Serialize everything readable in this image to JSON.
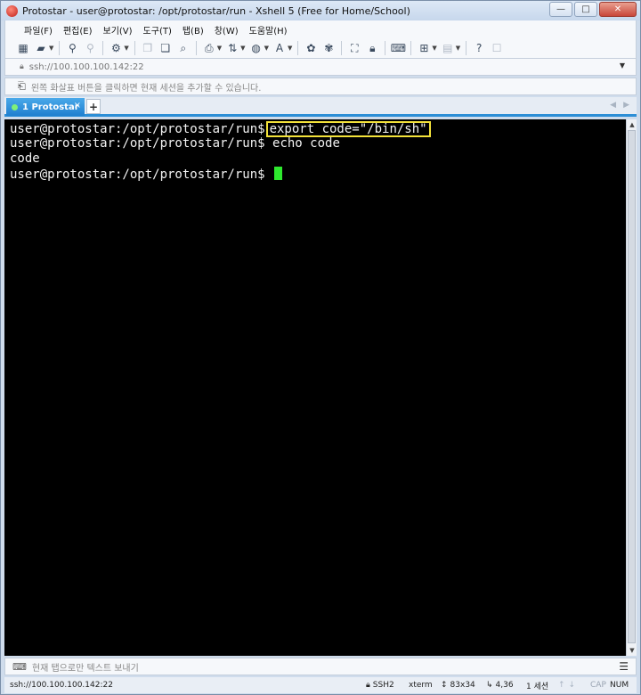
{
  "window": {
    "title": "Protostar - user@protostar: /opt/protostar/run - Xshell 5 (Free for Home/School)",
    "controls": {
      "minimize": "—",
      "maximize": "□",
      "close": "✕"
    }
  },
  "menu": {
    "items": [
      "파일(F)",
      "편집(E)",
      "보기(V)",
      "도구(T)",
      "탭(B)",
      "창(W)",
      "도움말(H)"
    ]
  },
  "address": {
    "value": "ssh://100.100.100.142:22"
  },
  "hint": {
    "text": "왼쪽 화살표 버튼을 클릭하면 현재 세션을 추가할 수 있습니다."
  },
  "tabs": {
    "active_label": "1 Protostar",
    "close": "×",
    "add": "+",
    "scroll_left": "◀",
    "scroll_right": "▶"
  },
  "terminal": {
    "prompt": "user@protostar:/opt/protostar/run$",
    "line1_command": "export code=\"/bin/sh\"",
    "line2_command": "echo code",
    "line3_output": "code",
    "line4_prompt": "user@protostar:/opt/protostar/run$",
    "highlight_color": "#f3e23a",
    "cursor_color": "#2ee82e",
    "background": "#000000",
    "foreground": "#f2f2f2"
  },
  "compose": {
    "placeholder": "현재 탭으로만 텍스트 보내기"
  },
  "status": {
    "connection": "ssh://100.100.100.142:22",
    "protocol": "SSH2",
    "terminal_type": "xterm",
    "size": "83x34",
    "position": "4,36",
    "sessions": "1 세션",
    "caps": "CAP",
    "num": "NUM"
  },
  "colors": {
    "tab_active": "#2c8ed6",
    "chrome": "#cfdcec"
  }
}
